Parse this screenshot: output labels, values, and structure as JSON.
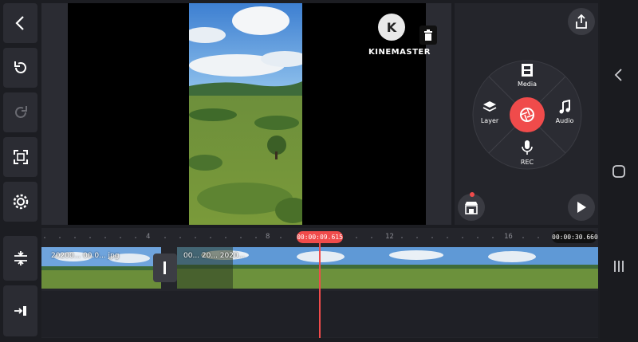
{
  "app": {
    "name": "KINEMASTER",
    "logo_letter": "K"
  },
  "left_toolbar": [
    {
      "name": "back-button",
      "icon": "chevron-left-icon"
    },
    {
      "name": "undo-button",
      "icon": "undo-icon"
    },
    {
      "name": "redo-button",
      "icon": "redo-icon"
    },
    {
      "name": "capture-button",
      "icon": "frame-capture-icon"
    },
    {
      "name": "settings-button",
      "icon": "gear-icon"
    }
  ],
  "radial_menu": {
    "media": "Media",
    "layer": "Layer",
    "audio": "Audio",
    "rec": "REC",
    "accent": "#f04b4b"
  },
  "timeline": {
    "playhead_time": "00:00:09.615",
    "total_time": "00:00:30.660",
    "ruler_ticks": [
      "4",
      "8",
      "12",
      "16"
    ],
    "clip_a_label": "20200... 00.0... jpg",
    "clip_b_label": "00... 20... 2020..."
  },
  "colors": {
    "accent": "#f04b4b",
    "panel": "#2b2c33",
    "background": "#1c1d22"
  }
}
